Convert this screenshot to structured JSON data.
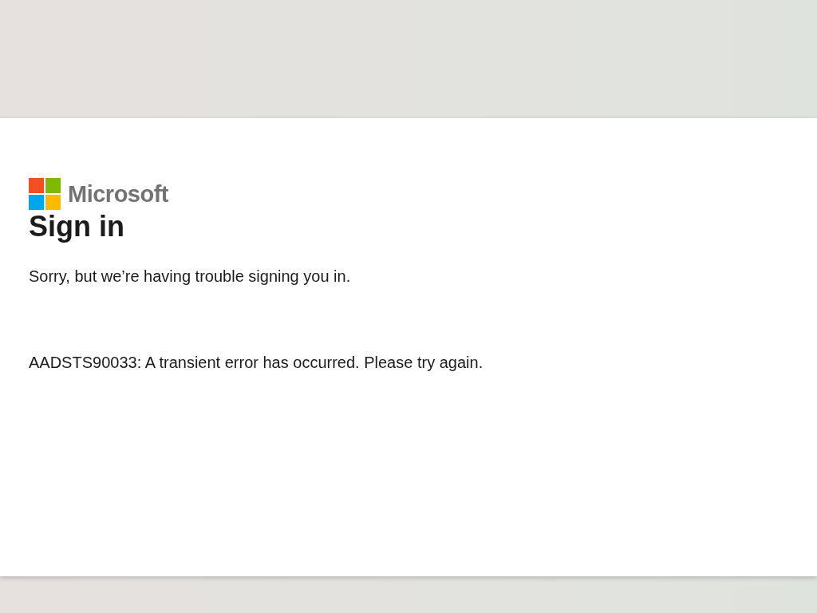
{
  "logo": {
    "text": "Microsoft"
  },
  "title": "Sign in",
  "message": "Sorry, but we’re having trouble signing you in.",
  "error": "AADSTS90033: A transient error has occurred. Please try again."
}
